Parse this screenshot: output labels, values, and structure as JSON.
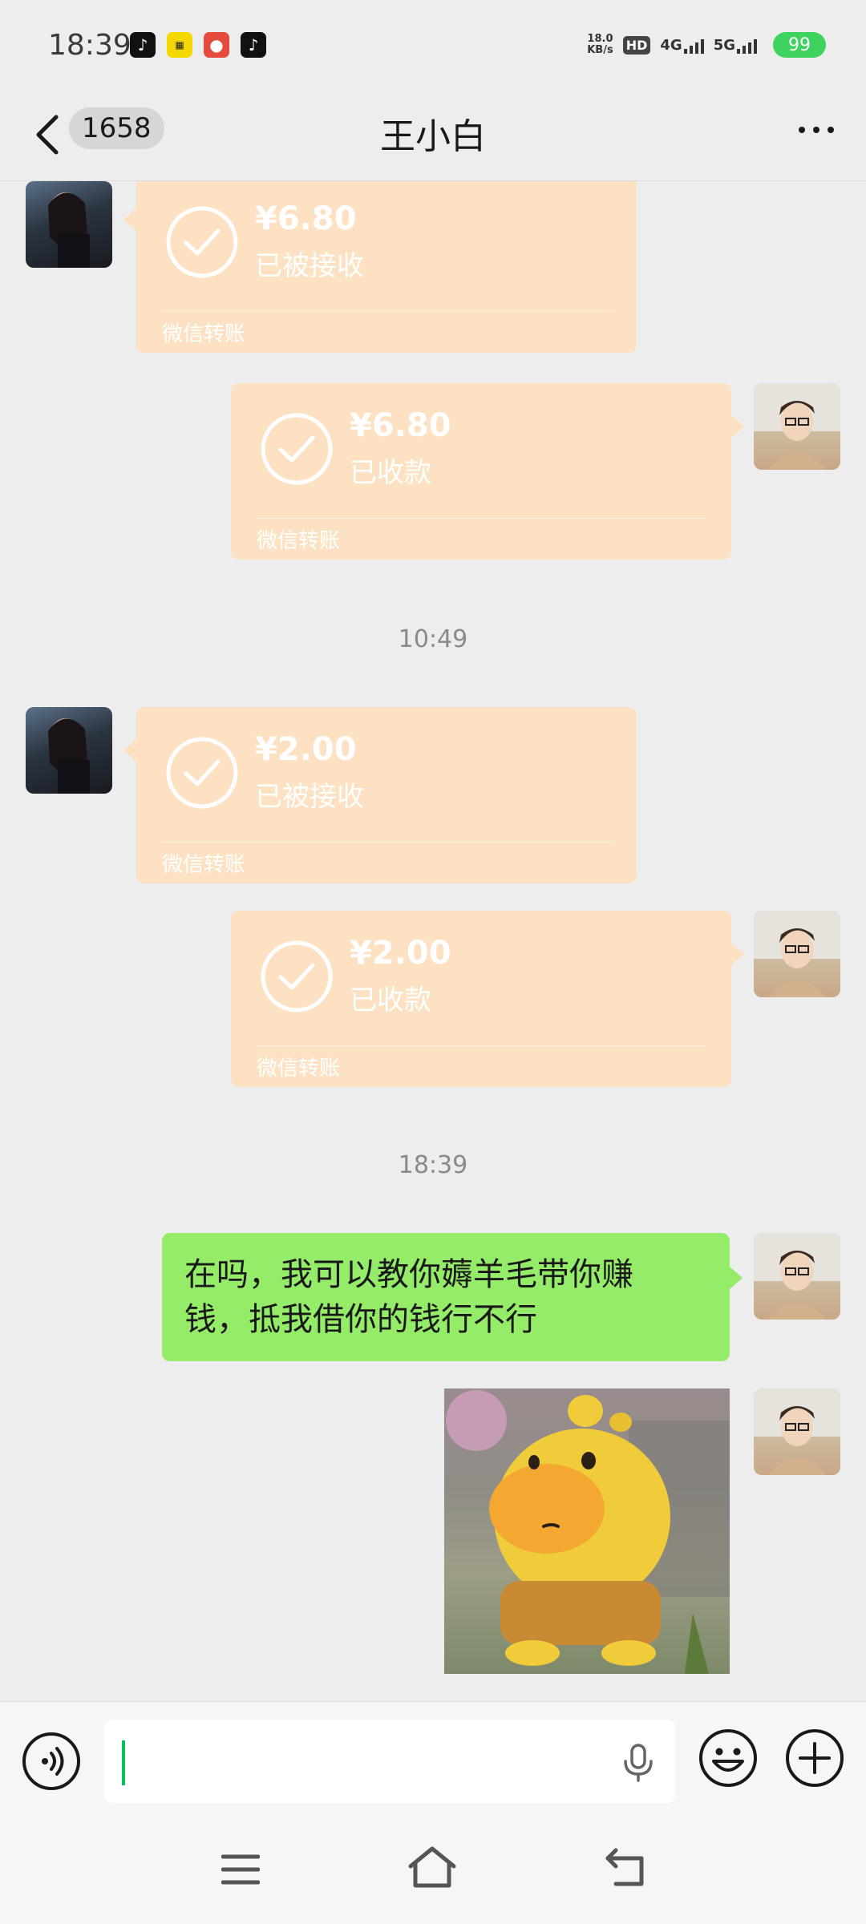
{
  "status_bar": {
    "time": "18:39",
    "net_speed_value": "18.0",
    "net_speed_unit": "KB/s",
    "hd_label": "HD",
    "sim1_label": "4G",
    "sim2_label": "5G",
    "battery": "99",
    "apps": [
      "tiktok-icon",
      "app-icon",
      "app-icon",
      "tiktok-icon"
    ]
  },
  "nav": {
    "unread_count": "1658",
    "title": "王小白"
  },
  "messages": [
    {
      "sender": "contact",
      "type": "transfer",
      "amount": "¥6.80",
      "status": "已被接收",
      "label": "微信转账"
    },
    {
      "sender": "me",
      "type": "transfer",
      "amount": "¥6.80",
      "status": "已收款",
      "label": "微信转账"
    },
    {
      "type": "timestamp",
      "text": "10:49"
    },
    {
      "sender": "contact",
      "type": "transfer",
      "amount": "¥2.00",
      "status": "已被接收",
      "label": "微信转账"
    },
    {
      "sender": "me",
      "type": "transfer",
      "amount": "¥2.00",
      "status": "已收款",
      "label": "微信转账"
    },
    {
      "type": "timestamp",
      "text": "18:39"
    },
    {
      "sender": "me",
      "type": "text",
      "text_line1": "在吗，我可以教你薅羊毛带你赚",
      "text_line2": "钱，抵我借你的钱行不行"
    },
    {
      "sender": "me",
      "type": "sticker",
      "content": "yellow-cartoon-creature"
    }
  ],
  "colors": {
    "background": "#ededed",
    "transfer_bubble": "#fde1c3",
    "my_text_bubble": "#95ec69",
    "battery": "#3ed35f",
    "cursor": "#07c160"
  }
}
